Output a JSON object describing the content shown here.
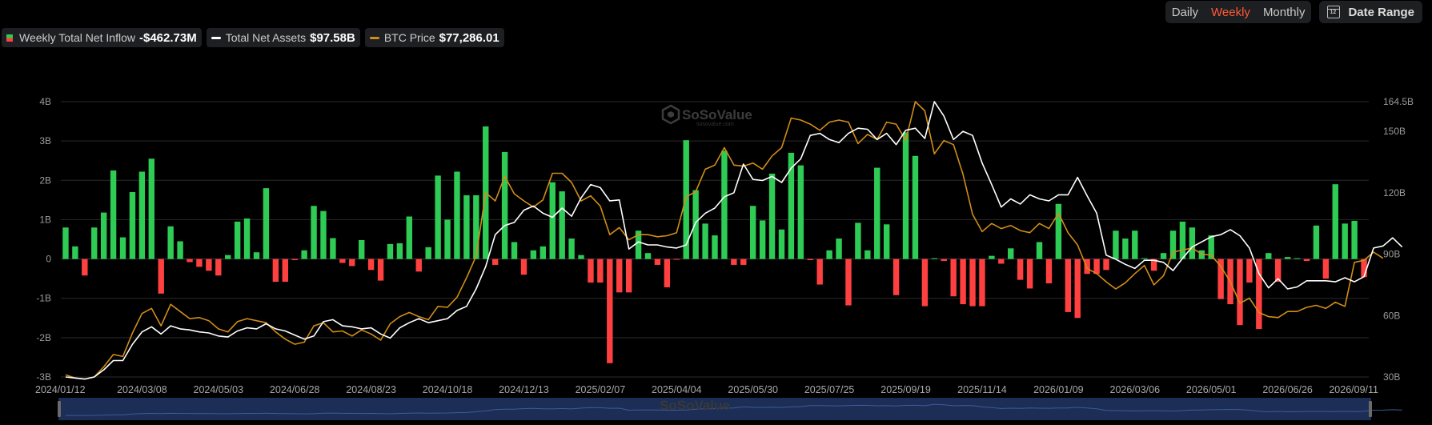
{
  "controls": {
    "periods": [
      "Daily",
      "Weekly",
      "Monthly"
    ],
    "active_period": "Weekly",
    "date_range_label": "Date Range",
    "calendar_day": "12"
  },
  "legend": {
    "net_inflow": {
      "label": "Weekly Total Net Inflow",
      "value": "-$462.73M"
    },
    "net_assets": {
      "label": "Total Net Assets",
      "value": "$97.58B"
    },
    "btc_price": {
      "label": "BTC Price",
      "value": "$77,286.01"
    }
  },
  "watermark": {
    "brand": "SoSoValue",
    "site": "sosovalue.com"
  },
  "colors": {
    "positive": "#2ecc55",
    "negative": "#ff4040",
    "assets_line": "#ffffff",
    "btc_line": "#d18d16",
    "grid": "#2a2a2a",
    "navigator": "#1c2e55"
  },
  "chart_data": {
    "type": "bar",
    "left_axis": {
      "ticks": [
        4,
        3,
        2,
        1,
        0,
        -1,
        -2,
        -3
      ],
      "tick_labels": [
        "4B",
        "3B",
        "2B",
        "1B",
        "0",
        "-1B",
        "-2B",
        "-3B"
      ],
      "ylim": [
        -3,
        4
      ]
    },
    "right_axis": {
      "ticks": [
        164.5,
        150,
        120,
        90,
        60,
        30
      ],
      "tick_labels": [
        "164.5B",
        "150B",
        "120B",
        "90B",
        "60B",
        "30B"
      ],
      "ylim": [
        30,
        164.5
      ]
    },
    "x_tick_labels": [
      "2024/01/12",
      "2024/03/08",
      "2024/05/03",
      "2024/06/28",
      "2024/08/23",
      "2024/10/18",
      "2024/12/13",
      "2025/02/07",
      "2025/04/04",
      "2025/05/30",
      "2025/07/25",
      "2025/09/19",
      "2025/11/14",
      "2026/01/09",
      "2026/03/06",
      "2026/05/01",
      "2026/06/26",
      "2026/09/11"
    ],
    "series": [
      {
        "name": "Weekly Total Net Inflow",
        "type": "bar",
        "unit": "B USD",
        "values": [
          0.8,
          0.32,
          -0.42,
          0.8,
          1.18,
          2.25,
          0.55,
          1.7,
          2.22,
          2.55,
          -0.88,
          0.83,
          0.45,
          -0.08,
          -0.2,
          -0.3,
          -0.42,
          0.1,
          0.95,
          1.03,
          0.17,
          1.8,
          -0.58,
          -0.58,
          -0.03,
          0.22,
          1.35,
          1.22,
          0.53,
          -0.1,
          -0.18,
          0.48,
          -0.28,
          -0.55,
          0.38,
          0.4,
          1.08,
          -0.32,
          0.3,
          2.12,
          1.0,
          2.22,
          1.62,
          1.62,
          3.37,
          -0.15,
          2.72,
          0.43,
          -0.4,
          0.22,
          0.32,
          1.95,
          1.72,
          0.52,
          0.1,
          -0.6,
          -0.6,
          -2.65,
          -0.85,
          -0.85,
          0.72,
          0.15,
          -0.15,
          -0.72,
          -0.02,
          3.02,
          1.75,
          0.9,
          0.6,
          2.75,
          -0.15,
          -0.15,
          1.35,
          0.98,
          2.17,
          0.75,
          2.7,
          2.38,
          -0.03,
          -0.65,
          0.22,
          0.52,
          -1.18,
          0.92,
          0.22,
          2.32,
          0.88,
          -0.92,
          3.22,
          2.62,
          -1.2,
          0.02,
          -0.05,
          -0.95,
          -1.15,
          -1.2,
          -1.2,
          0.08,
          -0.12,
          0.27,
          -0.53,
          -0.75,
          0.43,
          -0.62,
          1.4,
          -1.35,
          -1.5,
          -0.38,
          -0.38,
          -0.28,
          0.72,
          0.52,
          0.72,
          0.02,
          -0.3,
          0.15,
          0.72,
          0.95,
          0.8,
          0.22,
          0.6,
          -1.02,
          -1.15,
          -1.68,
          -0.6,
          -1.78,
          0.15,
          -0.58,
          0.05,
          0.02,
          -0.05,
          0.85,
          -0.5,
          1.9,
          0.9,
          0.97,
          -0.46
        ]
      },
      {
        "name": "Total Net Assets",
        "type": "line",
        "unit": "B USD",
        "values": [
          30.0,
          29.5,
          29.0,
          30.0,
          33.5,
          38.0,
          38.0,
          46.0,
          52.0,
          54.5,
          51.0,
          55.0,
          53.5,
          53.0,
          52.0,
          51.5,
          50.0,
          49.5,
          52.5,
          54.0,
          53.5,
          56.0,
          53.5,
          52.5,
          50.5,
          48.5,
          50.0,
          57.0,
          58.0,
          55.0,
          54.5,
          53.5,
          54.0,
          51.0,
          49.0,
          54.0,
          56.5,
          58.5,
          56.5,
          57.5,
          58.5,
          62.5,
          64.5,
          73.0,
          84.0,
          99.5,
          104.0,
          105.5,
          111.5,
          113.5,
          110.0,
          108.0,
          112.5,
          108.5,
          117.5,
          124.0,
          122.5,
          116.0,
          116.5,
          92.5,
          96.0,
          94.5,
          94.5,
          93.5,
          93.0,
          94.5,
          105.5,
          110.0,
          112.5,
          118.0,
          120.0,
          134.0,
          126.5,
          126.0,
          128.0,
          125.0,
          132.0,
          136.5,
          148.0,
          149.0,
          146.0,
          144.5,
          149.0,
          151.5,
          151.0,
          146.0,
          149.0,
          143.5,
          150.5,
          151.5,
          146.5,
          164.5,
          157.5,
          146.0,
          150.0,
          148.0,
          134.5,
          124.0,
          113.0,
          117.0,
          114.5,
          119.0,
          117.0,
          116.0,
          119.0,
          119.0,
          127.5,
          118.5,
          110.0,
          89.5,
          87.5,
          85.0,
          83.0,
          87.0,
          87.0,
          86.0,
          82.0,
          88.0,
          93.5,
          96.0,
          98.5,
          99.5,
          102.0,
          99.0,
          93.0,
          80.5,
          73.5,
          78.0,
          73.0,
          74.0,
          77.0,
          77.0,
          77.0,
          76.5,
          78.5,
          76.5,
          79.0,
          93.0,
          94.0,
          98.0,
          93.5
        ]
      },
      {
        "name": "BTC Price",
        "type": "line",
        "unit": "scaled to right axis",
        "values": [
          31.0,
          29.5,
          29.0,
          30.0,
          35.0,
          41.0,
          40.0,
          51.5,
          61.0,
          63.5,
          55.0,
          65.5,
          62.0,
          58.5,
          59.0,
          57.5,
          53.5,
          52.0,
          57.0,
          58.5,
          57.5,
          56.5,
          52.0,
          48.5,
          46.0,
          47.0,
          55.0,
          56.5,
          52.0,
          52.5,
          50.0,
          53.0,
          51.0,
          48.0,
          56.0,
          59.5,
          61.5,
          59.5,
          58.0,
          64.5,
          64.0,
          69.0,
          78.5,
          89.0,
          120.0,
          116.0,
          128.0,
          119.5,
          116.0,
          113.0,
          116.5,
          129.5,
          129.5,
          125.0,
          116.0,
          118.5,
          113.5,
          99.5,
          103.0,
          97.0,
          99.5,
          99.5,
          98.5,
          99.0,
          100.5,
          118.0,
          120.5,
          131.5,
          133.5,
          142.0,
          133.5,
          133.0,
          134.5,
          131.5,
          138.0,
          142.0,
          156.5,
          155.5,
          153.5,
          150.5,
          154.5,
          155.5,
          154.5,
          144.0,
          148.5,
          146.0,
          154.5,
          153.5,
          145.5,
          164.5,
          160.0,
          139.0,
          145.5,
          143.5,
          129.0,
          109.5,
          101.0,
          105.0,
          102.5,
          104.0,
          101.5,
          100.5,
          105.0,
          102.5,
          110.0,
          100.5,
          94.5,
          83.0,
          80.5,
          76.5,
          73.0,
          76.0,
          80.5,
          84.5,
          75.0,
          79.5,
          91.0,
          92.0,
          93.0,
          90.0,
          89.5,
          84.0,
          76.5,
          66.0,
          68.5,
          61.5,
          59.5,
          59.0,
          62.0,
          62.0,
          64.0,
          65.0,
          63.5,
          66.5,
          64.5,
          86.0,
          87.0,
          91.0,
          88.0
        ]
      }
    ]
  }
}
